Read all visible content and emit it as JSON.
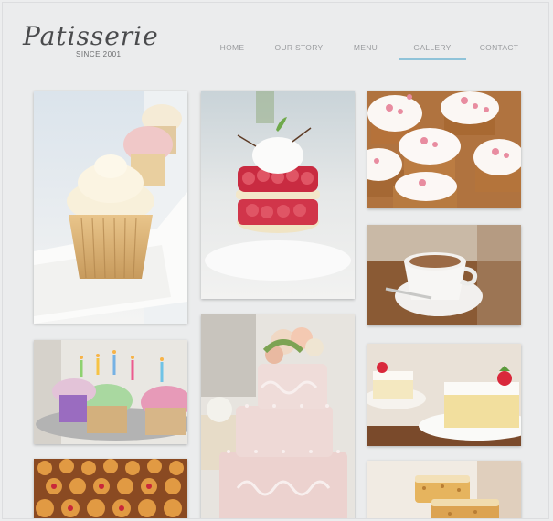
{
  "brand": {
    "name": "Patisserie",
    "tagline": "SINCE 2001"
  },
  "nav": {
    "items": [
      {
        "label": "HOME"
      },
      {
        "label": "OUR STORY"
      },
      {
        "label": "MENU"
      },
      {
        "label": "GALLERY",
        "active": true
      },
      {
        "label": "CONTACT"
      }
    ]
  },
  "gallery": {
    "tiles": [
      {
        "subject": "cupcakes-in-white-tray"
      },
      {
        "subject": "raspberry-tartlet-with-cream"
      },
      {
        "subject": "frosted-cupcakes-with-sprinkles"
      },
      {
        "subject": "coffee-cup-on-saucer"
      },
      {
        "subject": "birthday-cupcakes-with-candles"
      },
      {
        "subject": "pink-tiered-wedding-cake"
      },
      {
        "subject": "strawberry-cream-cake-slices"
      },
      {
        "subject": "mini-fruit-tarts"
      },
      {
        "subject": "baked-pastries"
      }
    ]
  },
  "colors": {
    "page_bg": "#ebeced",
    "nav_text": "#9a9c9f",
    "nav_active_underline": "#8fc3d9",
    "logo_text": "#4a4b4d"
  }
}
